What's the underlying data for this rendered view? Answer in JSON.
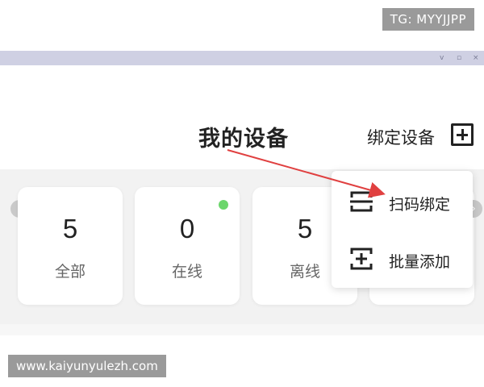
{
  "watermark": {
    "tg": "TG: MYYJJPP",
    "url": "www.kaiyunyulezh.com"
  },
  "header": {
    "title": "我的设备",
    "bind_label": "绑定设备"
  },
  "window_controls": {
    "minimize": "v",
    "restore": "▫",
    "close": "×"
  },
  "cards": [
    {
      "count": "5",
      "label": "全部"
    },
    {
      "count": "0",
      "label": "在线"
    },
    {
      "count": "5",
      "label": "离线"
    }
  ],
  "dropdown": {
    "items": [
      {
        "label": "扫码绑定",
        "icon": "scan-icon"
      },
      {
        "label": "批量添加",
        "icon": "batch-add-icon"
      }
    ]
  },
  "nav": {
    "prev": "‹",
    "next": "›"
  },
  "colors": {
    "online": "#6cd66c",
    "annotation_arrow": "#e04040",
    "titlebar": "#cfd0e3"
  }
}
